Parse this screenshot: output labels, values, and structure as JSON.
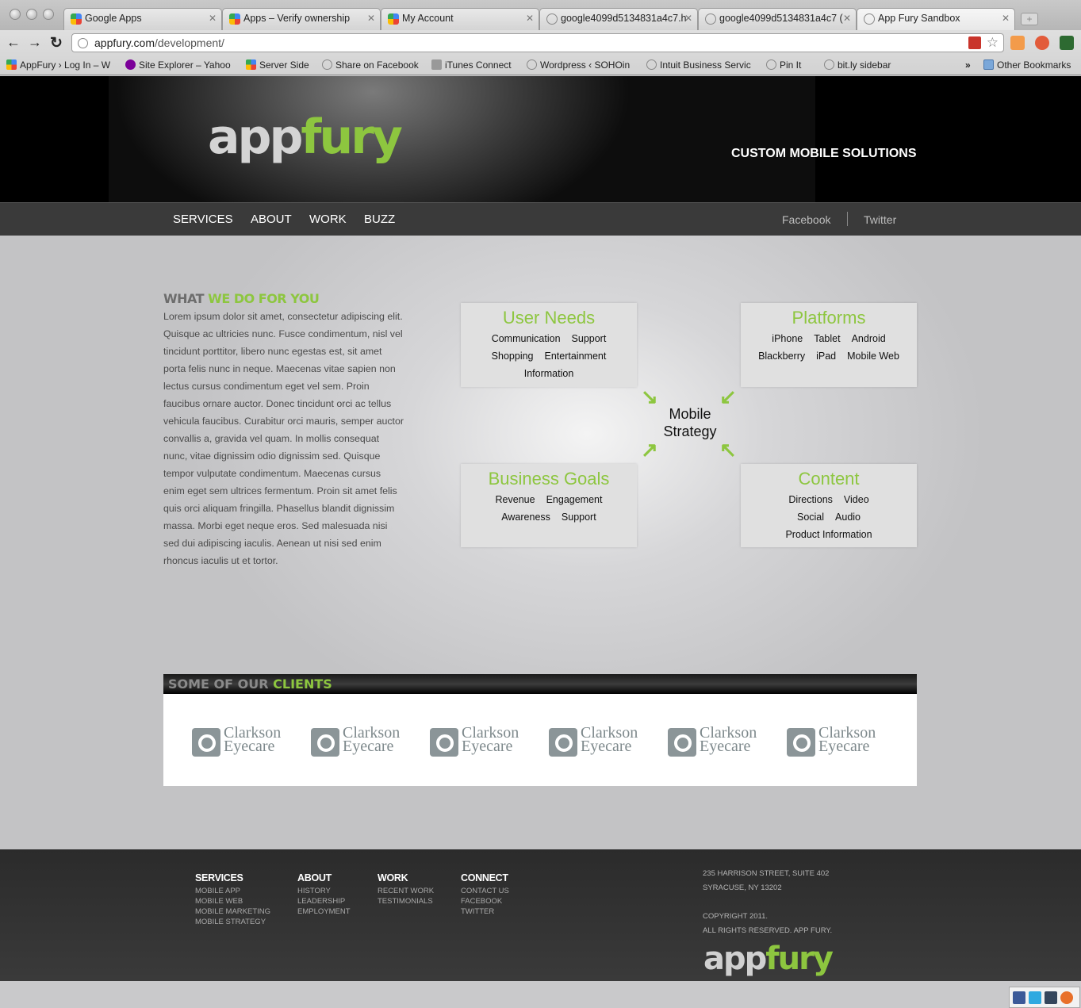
{
  "browser": {
    "tabs": [
      {
        "title": "Google Apps"
      },
      {
        "title": "Apps – Verify ownership"
      },
      {
        "title": "My Account"
      },
      {
        "title": "google4099d5134831a4c7.h"
      },
      {
        "title": "google4099d5134831a4c7 ("
      },
      {
        "title": "App Fury Sandbox"
      }
    ],
    "url_host": "appfury.com",
    "url_path": "/development/",
    "bookmarks": [
      "AppFury › Log In – W",
      "Site Explorer – Yahoo",
      "Server Side",
      "Share on Facebook",
      "iTunes Connect",
      "Wordpress ‹ SOHOin",
      "Intuit Business Servic",
      "Pin It",
      "bit.ly sidebar"
    ],
    "overflow": "»",
    "other_bookmarks": "Other Bookmarks"
  },
  "site": {
    "logo_a": "app",
    "logo_b": "fury",
    "tagline": "CUSTOM MOBILE SOLUTIONS",
    "nav": [
      "SERVICES",
      "ABOUT",
      "WORK",
      "BUZZ"
    ],
    "social": [
      "Facebook",
      "Twitter"
    ]
  },
  "what": {
    "title_a": "WHAT ",
    "title_b": "WE DO FOR YOU",
    "body": "Lorem ipsum dolor sit amet, consectetur adipiscing elit. Quisque ac ultricies nunc. Fusce condimentum, nisl vel tincidunt porttitor, libero nunc egestas est, sit amet porta felis nunc in neque. Maecenas vitae sapien non lectus cursus condimentum eget vel sem. Proin faucibus ornare auctor. Donec tincidunt orci ac tellus vehicula faucibus. Curabitur orci mauris, semper auctor convallis a, gravida vel quam. In mollis consequat nunc, vitae dignissim odio dignissim sed. Quisque tempor vulputate condimentum. Maecenas cursus enim eget sem ultrices fermentum. Proin sit amet felis quis orci aliquam fringilla. Phasellus blandit dignissim massa. Morbi eget neque eros. Sed malesuada nisi sed dui adipiscing iaculis. Aenean ut nisi sed enim rhoncus iaculis ut et tortor."
  },
  "diagram": {
    "center_1": "Mobile",
    "center_2": "Strategy",
    "user_needs": {
      "title": "User Needs",
      "r1": [
        "Communication",
        "Support"
      ],
      "r2": [
        "Shopping",
        "Entertainment"
      ],
      "r3": [
        "Information"
      ]
    },
    "platforms": {
      "title": "Platforms",
      "r1": [
        "iPhone",
        "Tablet",
        "Android"
      ],
      "r2": [
        "Blackberry",
        "iPad",
        "Mobile Web"
      ]
    },
    "business": {
      "title": "Business Goals",
      "r1": [
        "Revenue",
        "Engagement"
      ],
      "r2": [
        "Awareness",
        "Support"
      ]
    },
    "content": {
      "title": "Content",
      "r1": [
        "Directions",
        "Video"
      ],
      "r2": [
        "Social",
        "Audio"
      ],
      "r3": [
        "Product Information"
      ]
    }
  },
  "clients": {
    "title_a": "SOME OF OUR ",
    "title_b": "CLIENTS",
    "logos": [
      {
        "l1": "Clarkson",
        "l2": "Eyecare"
      },
      {
        "l1": "Clarkson",
        "l2": "Eyecare"
      },
      {
        "l1": "Clarkson",
        "l2": "Eyecare"
      },
      {
        "l1": "Clarkson",
        "l2": "Eyecare"
      },
      {
        "l1": "Clarkson",
        "l2": "Eyecare"
      },
      {
        "l1": "Clarkson",
        "l2": "Eyecare"
      }
    ]
  },
  "footer": {
    "services": {
      "title": "SERVICES",
      "links": [
        "MOBILE APP",
        "MOBILE WEB",
        "MOBILE MARKETING",
        "MOBILE STRATEGY"
      ]
    },
    "about": {
      "title": "ABOUT",
      "links": [
        "HISTORY",
        "LEADERSHIP",
        "EMPLOYMENT"
      ]
    },
    "work": {
      "title": "WORK",
      "links": [
        "RECENT WORK",
        "TESTIMONIALS"
      ]
    },
    "connect": {
      "title": "CONNECT",
      "links": [
        "CONTACT US",
        "FACEBOOK",
        "TWITTER"
      ]
    },
    "address_1": "235 HARRISON STREET, SUITE 402",
    "address_2": "SYRACUSE, NY 13202",
    "copyright_1": "COPYRIGHT 2011.",
    "copyright_2": "ALL RIGHTS RESERVED. APP FURY."
  },
  "colors": {
    "accent": "#8dc63f"
  }
}
